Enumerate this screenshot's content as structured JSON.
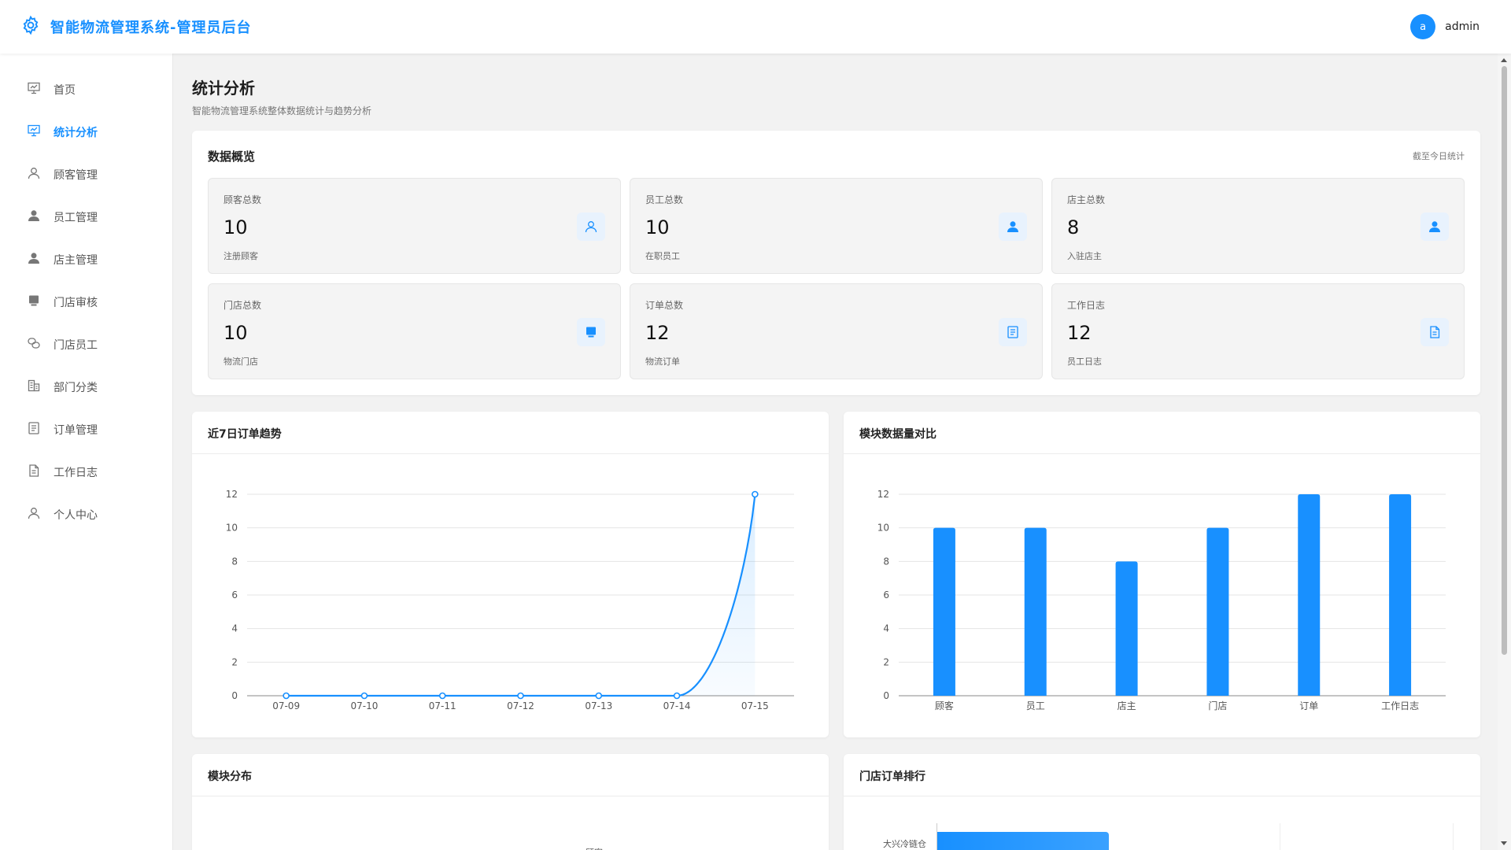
{
  "header": {
    "title": "智能物流管理系统-管理员后台",
    "avatar_letter": "a",
    "username": "admin"
  },
  "sidebar": {
    "items": [
      {
        "label": "首页",
        "icon": "dashboard-icon"
      },
      {
        "label": "统计分析",
        "icon": "chart-board-icon",
        "active": true
      },
      {
        "label": "顾客管理",
        "icon": "user-outline-icon"
      },
      {
        "label": "员工管理",
        "icon": "user-filled-icon"
      },
      {
        "label": "店主管理",
        "icon": "user-filled-icon"
      },
      {
        "label": "门店审核",
        "icon": "shop-icon"
      },
      {
        "label": "门店员工",
        "icon": "link-icon"
      },
      {
        "label": "部门分类",
        "icon": "building-icon"
      },
      {
        "label": "订单管理",
        "icon": "list-icon"
      },
      {
        "label": "工作日志",
        "icon": "document-icon"
      },
      {
        "label": "个人中心",
        "icon": "user-outline-icon"
      }
    ]
  },
  "page": {
    "title": "统计分析",
    "subtitle": "智能物流管理系统整体数据统计与趋势分析"
  },
  "overview": {
    "title": "数据概览",
    "note": "截至今日统计",
    "stats": [
      {
        "label": "顾客总数",
        "value": "10",
        "desc": "注册顾客",
        "icon": "user-outline-icon"
      },
      {
        "label": "员工总数",
        "value": "10",
        "desc": "在职员工",
        "icon": "user-filled-icon"
      },
      {
        "label": "店主总数",
        "value": "8",
        "desc": "入驻店主",
        "icon": "user-filled-icon"
      },
      {
        "label": "门店总数",
        "value": "10",
        "desc": "物流门店",
        "icon": "shop-icon"
      },
      {
        "label": "订单总数",
        "value": "12",
        "desc": "物流订单",
        "icon": "list-icon"
      },
      {
        "label": "工作日志",
        "value": "12",
        "desc": "员工日志",
        "icon": "document-icon"
      }
    ]
  },
  "panels": {
    "trend_title": "近7日订单趋势",
    "compare_title": "模块数据量对比",
    "distribution_title": "模块分布",
    "ranking_title": "门店订单排行",
    "distribution_partial_label": "顾客",
    "ranking_partial_label": "大兴冷链仓"
  },
  "colors": {
    "accent": "#1890ff",
    "background": "#f2f2f2",
    "card": "#ffffff"
  },
  "chart_data": [
    {
      "type": "line",
      "title": "近7日订单趋势",
      "x": [
        "07-09",
        "07-10",
        "07-11",
        "07-12",
        "07-13",
        "07-14",
        "07-15"
      ],
      "series": [
        {
          "values": [
            0,
            0,
            0,
            0,
            0,
            0,
            12
          ]
        }
      ],
      "ylim": [
        0,
        12
      ],
      "yticks": [
        0,
        2,
        4,
        6,
        8,
        10,
        12
      ],
      "smooth": true,
      "area": true,
      "grid": true
    },
    {
      "type": "bar",
      "title": "模块数据量对比",
      "categories": [
        "顾客",
        "员工",
        "店主",
        "门店",
        "订单",
        "工作日志"
      ],
      "values": [
        10,
        10,
        8,
        10,
        12,
        12
      ],
      "ylim": [
        0,
        12
      ],
      "yticks": [
        0,
        2,
        4,
        6,
        8,
        10,
        12
      ],
      "grid": true
    }
  ]
}
